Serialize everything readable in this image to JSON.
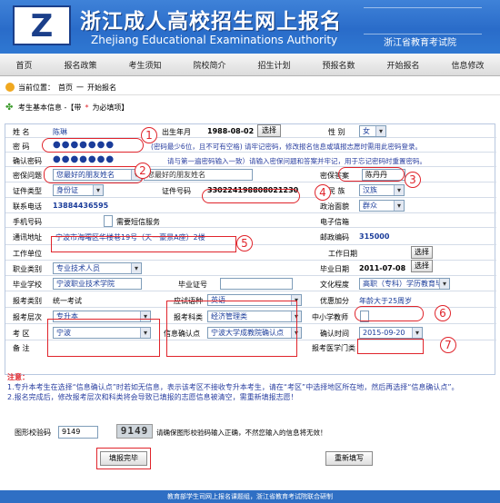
{
  "header": {
    "title_cn": "浙江成人高校招生网上报名",
    "title_en": "Zhejiang Educational Examinations Authority",
    "dept": "浙江省教育考试院"
  },
  "nav": [
    "首页",
    "报名政策",
    "考生须知",
    "院校简介",
    "招生计划",
    "预报名数",
    "开始报名",
    "信息修改"
  ],
  "breadcrumb": {
    "label": "当前位置：",
    "home": "首页",
    "sep": "一",
    "current": "开始报名"
  },
  "section": {
    "title": "考生基本信息 -【带",
    "required": "*",
    "title_end": "为必填项】"
  },
  "form": {
    "name_label": "姓  名",
    "name_value": "陈琳",
    "birth_label": "出生年月",
    "birth_value": "1988-08-02",
    "select_btn": "选择",
    "gender_label": "性  别",
    "gender_value": "女",
    "password_label": "密  码",
    "password_value": "●●●●●●●",
    "password_hint": "(密码最少6位，且不可有空格) 请牢记密码，修改报名信息或填报志愿时需用此密码登录。",
    "confirm_label": "确认密码",
    "confirm_value": "●●●●●●●",
    "confirm_hint": "请与第一遍密码输入一致）请输入密保问题和答案并牢记，用于忘记密码时重置密码。",
    "question_label": "密保问题",
    "question_value": "您最好的朋友姓名",
    "answer_label": "密保答案",
    "answer_value": "陈丹丹",
    "idtype_label": "证件类型",
    "idtype_value": "身份证",
    "idno_label": "证件号码",
    "idno_value": "330224198808021230",
    "nation_label": "民  族",
    "nation_value": "汉族",
    "phone_label": "联系电话",
    "phone_value": "13884436595",
    "politics_label": "政治面貌",
    "politics_value": "群众",
    "mobile_label": "手机号码",
    "sms_label": "需要短信服务",
    "email_label": "电子信箱",
    "address_label": "通讯地址",
    "address_value": "宁波市海曙区华楼巷19号（天一豪景A座）2楼",
    "zip_label": "邮政编码",
    "zip_value": "315000",
    "work_label": "工作单位",
    "workdate_label": "工作日期",
    "job_label": "职业类别",
    "job_value": "专业技术人员",
    "grad_date_label": "毕业日期",
    "grad_date_value": "2011-07-08",
    "school_label": "毕业学校",
    "school_value": "宁波职业技术学院",
    "cert_label": "毕业证号",
    "edu_label": "文化程度",
    "edu_value": "高职（专科）学历教育毕业",
    "kind_label": "报考类别",
    "kind_value": "统一考试",
    "lang_label": "应试语种",
    "lang_value": "英语",
    "bonus_label": "优惠加分",
    "bonus_value": "年龄大于25周岁",
    "level_label": "报考层次",
    "level_value": "专升本",
    "subject_label": "报考科类",
    "subject_value": "经济管理类",
    "teacher_label": "中小学教师",
    "area_label": "考  区",
    "area_value": "宁波",
    "point_label": "信息确认点",
    "point_value": "宁波大学成教院确认点",
    "time_label": "确认时间",
    "time_value": "2015-09-20",
    "remark_label": "备  注",
    "remark2_label": "报考医学门类"
  },
  "notes": {
    "head": "注意：",
    "n1": "1.专升本考生在选择“信息确认点”时若如无信息，表示该考区不接收专升本考生，请在“考区”中选择地区所在地，然后再选择“信息确认点”。",
    "n2": "2.报名完成后，修改报考层次和科类将会导致已填报的志愿信息被清空，需重新填报志愿！"
  },
  "captcha": {
    "label": "图形校验码",
    "value": "9149",
    "image_text": "9149",
    "hint": "请确保图形校验码输入正确，不然您输入的信息将无效！"
  },
  "buttons": {
    "submit": "填报完毕",
    "reset": "重新填写"
  },
  "footer": "教育部学生司网上报名课题组，浙江省教育考试院联合研制",
  "markers": [
    "1",
    "2",
    "3",
    "4",
    "5",
    "6",
    "7"
  ],
  "colors": {
    "banner": "#2a6cc9",
    "annotation": "#e0242b",
    "value_text": "#1a3c9a"
  }
}
